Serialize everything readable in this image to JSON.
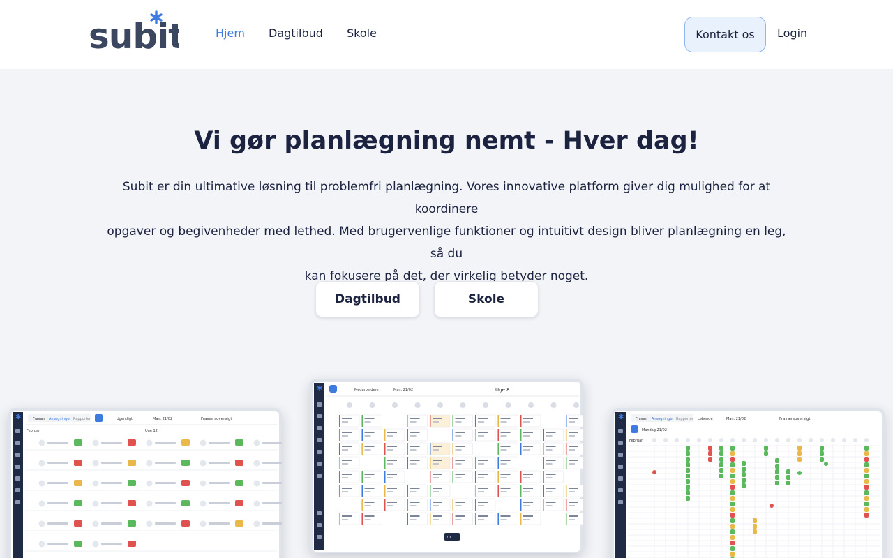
{
  "brand": {
    "name": "subit",
    "accent": "#3d7be0",
    "dark": "#3b4660"
  },
  "nav": {
    "home": "Hjem",
    "daycare": "Dagtilbud",
    "school": "Skole",
    "contact": "Kontakt os",
    "login": "Login"
  },
  "hero": {
    "title": "Vi gør planlægning nemt - Hver dag!",
    "lines": [
      "Subit er din ultimative løsning til problemfri planlægning. Vores innovative platform giver dig mulighed for at koordinere",
      "opgaver og begivenheder med lethed. Med brugervenlige funktioner og intuitivt design bliver planlægning en leg, så du",
      "kan fokusere på det, der virkelig betyder noget."
    ],
    "buttons": {
      "daycare": "Dagtilbud",
      "school": "Skole"
    }
  },
  "screenshots": {
    "left": {
      "tab_absence": "Fravær",
      "tab_applications": "Ansøgninger",
      "tab_reports": "Rapporter",
      "filter": "Ugentligt",
      "date": "Man. 21/02",
      "title": "Fraværsoversigt",
      "month": "Februar",
      "week": "Uge 12"
    },
    "center": {
      "title": "Uge 8",
      "view": "Medarbejdere",
      "date": "Man. 21/02"
    },
    "right": {
      "tab_absence": "Fravær",
      "tab_applications": "Ansøgninger",
      "tab_reports": "Rapporter",
      "filter": "Løbende",
      "date": "Man. 21/02",
      "title": "Fraværsoversigt",
      "day": "Mandag 21/02",
      "month": "Februar"
    }
  }
}
